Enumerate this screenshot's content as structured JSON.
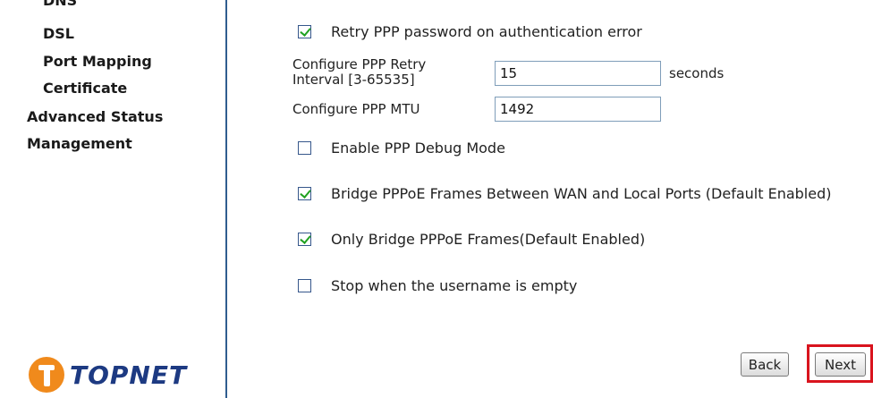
{
  "sidebar": {
    "items_clipped": "DNS",
    "items": [
      {
        "label": "DSL"
      },
      {
        "label": "Port Mapping"
      },
      {
        "label": "Certificate"
      }
    ],
    "top_items": [
      {
        "label": "Advanced Status"
      },
      {
        "label": "Management"
      }
    ],
    "logo_text": "TOPNET"
  },
  "form": {
    "retry_password": {
      "label": "Retry PPP password on authentication error",
      "checked": true
    },
    "retry_interval": {
      "label_line1": "Configure PPP Retry",
      "label_line2": "Interval [3-65535]",
      "value": "15",
      "unit": "seconds"
    },
    "mtu": {
      "label": "Configure PPP MTU",
      "value": "1492"
    },
    "debug_mode": {
      "label": "Enable PPP Debug Mode",
      "checked": false
    },
    "bridge_frames": {
      "label": "Bridge PPPoE Frames Between WAN and Local Ports (Default Enabled)",
      "checked": true
    },
    "only_bridge": {
      "label": "Only Bridge PPPoE Frames(Default Enabled)",
      "checked": true
    },
    "stop_empty": {
      "label": "Stop when the username is empty",
      "checked": false
    }
  },
  "buttons": {
    "back": "Back",
    "next": "Next"
  },
  "colors": {
    "sidebar_border": "#2f5d8f",
    "checkmark": "#21a121",
    "highlight": "#d9141e",
    "logo_orange": "#f08a1c",
    "logo_blue": "#1d3a82"
  }
}
